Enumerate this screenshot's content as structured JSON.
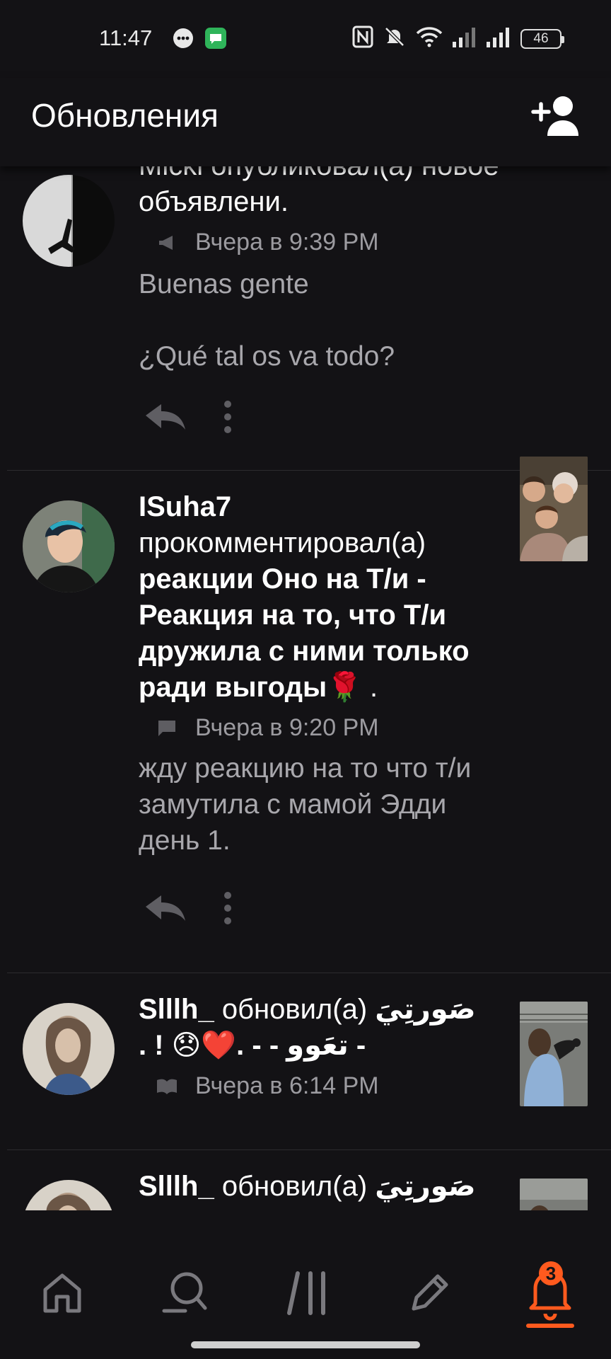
{
  "status_bar": {
    "time": "11:47",
    "battery": "46",
    "icons": [
      "chat-bubble-icon",
      "message-app-icon",
      "nfc-icon",
      "mute-icon",
      "wifi-icon",
      "signal-icon",
      "signal-icon",
      "battery-icon"
    ]
  },
  "header": {
    "title": "Обновления",
    "action_icon": "add-follow-icon"
  },
  "feed": [
    {
      "headline_partial": "Micki опубликовал(а) новое",
      "headline_tail": "объявлени.",
      "meta_icon": "megaphone-icon",
      "time": "Вчера в 9:39 PM",
      "body": "Buenas gente\n\n¿Qué tal os va todo?"
    },
    {
      "username": "ISuha7",
      "verb": "прокомментировал(а)",
      "target": "реакции Оно на Т/и - Реакция на то, что Т/и дружила с ними только ради выгоды🌹",
      "target_end": ".",
      "meta_icon": "comment-icon",
      "time": "Вчера в 9:20 PM",
      "body": "жду реакцию на то что т/и замутила с мамой Эдди день 1."
    },
    {
      "username": "Slllh_",
      "verb": "обновил(а)",
      "target": "صَورتِيَ - تعَوو - - .❤️😞 ! .",
      "meta_icon": "book-icon",
      "time": "Вчера в 6:14 PM"
    },
    {
      "username": "Slllh_",
      "verb": "обновил(а)",
      "target": "صَورتِيَ -"
    }
  ],
  "actions": {
    "reply_icon": "reply-icon",
    "more_icon": "more-vertical-icon"
  },
  "bottom_nav": {
    "items": [
      "home-icon",
      "search-icon",
      "library-icon",
      "write-icon",
      "notifications-icon"
    ],
    "badge": "3",
    "accent": "#ff5a1e"
  }
}
